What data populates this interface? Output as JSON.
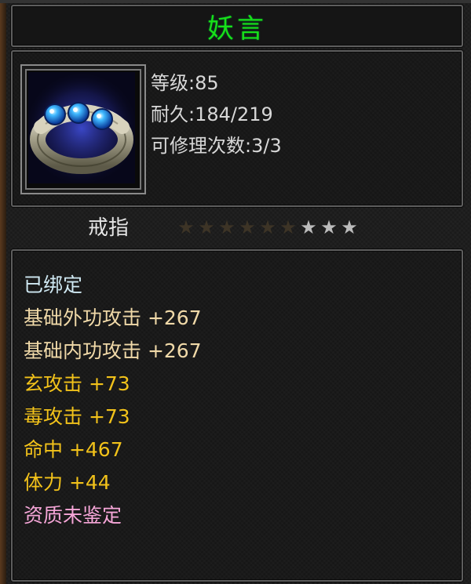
{
  "item": {
    "name": "妖言",
    "level": "等级:85",
    "durability": "耐久:184/219",
    "repair_count": "可修理次数:3/3",
    "type": "戒指",
    "stars_total": 9,
    "stars_lit": 3
  },
  "attributes": [
    {
      "text": "已绑定",
      "color": "#cfe8f2"
    },
    {
      "text": "基础外功攻击 +267",
      "color": "#f0d9a8"
    },
    {
      "text": "基础内功攻击 +267",
      "color": "#f0d9a8"
    },
    {
      "text": "玄攻击 +73",
      "color": "#f2c21a"
    },
    {
      "text": "毒攻击 +73",
      "color": "#f2c21a"
    },
    {
      "text": "命中 +467",
      "color": "#f2c21a"
    },
    {
      "text": "体力 +44",
      "color": "#f2c21a"
    },
    {
      "text": "资质未鉴定",
      "color": "#f6a6d8"
    }
  ],
  "colors": {
    "title": "#18e018",
    "frame": "#5d5d5d"
  },
  "icon": "ring-icon"
}
